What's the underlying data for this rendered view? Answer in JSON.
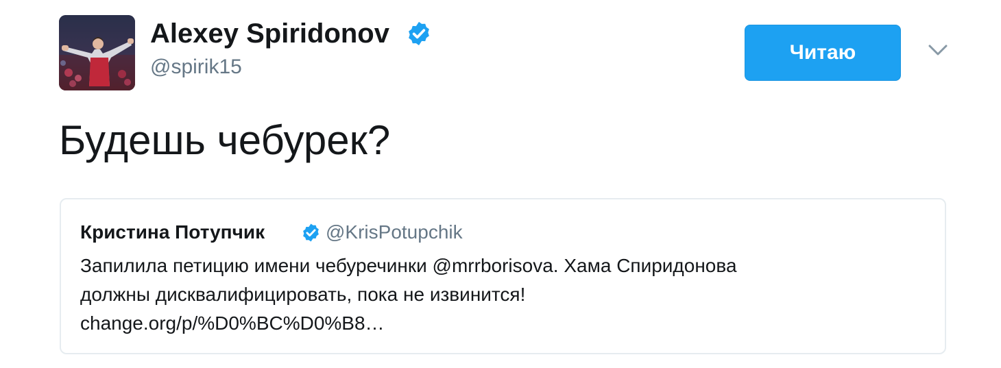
{
  "tweet": {
    "author": {
      "name": "Alexey Spiridonov",
      "handle": "@spirik15",
      "verified": true
    },
    "follow_button_label": "Читаю",
    "text": "Будешь чебурек?",
    "quoted_tweet": {
      "author_name": "Кристина Потупчик",
      "author_handle": "@KrisPotupchik",
      "verified": true,
      "text_lines": [
        "Запилила петицию имени чебуречинки @mrrborisova. Хама Спиридонова",
        "должны дисквалифицировать, пока не извинится!",
        "change.org/p/%D0%BC%D0%B8…"
      ]
    }
  },
  "icons": {
    "verified": "verified-badge-icon",
    "more": "chevron-down-icon"
  },
  "colors": {
    "accent": "#1da1f2",
    "text_primary": "#14171a",
    "text_secondary": "#657786",
    "card_border": "#e6ecf0"
  }
}
